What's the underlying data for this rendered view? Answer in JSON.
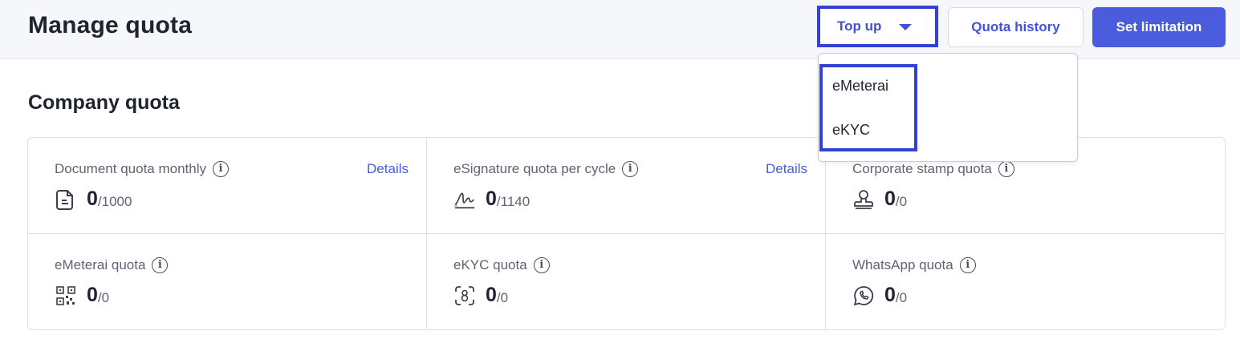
{
  "header": {
    "title": "Manage quota",
    "topup_label": "Top up",
    "history_label": "Quota history",
    "limit_label": "Set limitation"
  },
  "dropdown": {
    "items": [
      "eMeterai",
      "eKYC"
    ]
  },
  "section": {
    "title": "Company quota"
  },
  "quotas": [
    {
      "label": "Document quota monthly",
      "used": "0",
      "limit": "/1000",
      "details": "Details",
      "icon": "document-icon"
    },
    {
      "label": "eSignature quota per cycle",
      "used": "0",
      "limit": "/1140",
      "details": "Details",
      "icon": "signature-icon"
    },
    {
      "label": "Corporate stamp quota",
      "used": "0",
      "limit": "/0",
      "icon": "stamp-icon"
    },
    {
      "label": "eMeterai quota",
      "used": "0",
      "limit": "/0",
      "icon": "qr-code-icon"
    },
    {
      "label": "eKYC quota",
      "used": "0",
      "limit": "/0",
      "icon": "face-scan-icon"
    },
    {
      "label": "WhatsApp quota",
      "used": "0",
      "limit": "/0",
      "icon": "whatsapp-icon"
    }
  ],
  "colors": {
    "accent": "#4a5bdd",
    "highlight_border": "#3340d6",
    "header_bg": "#f6f7fa"
  }
}
